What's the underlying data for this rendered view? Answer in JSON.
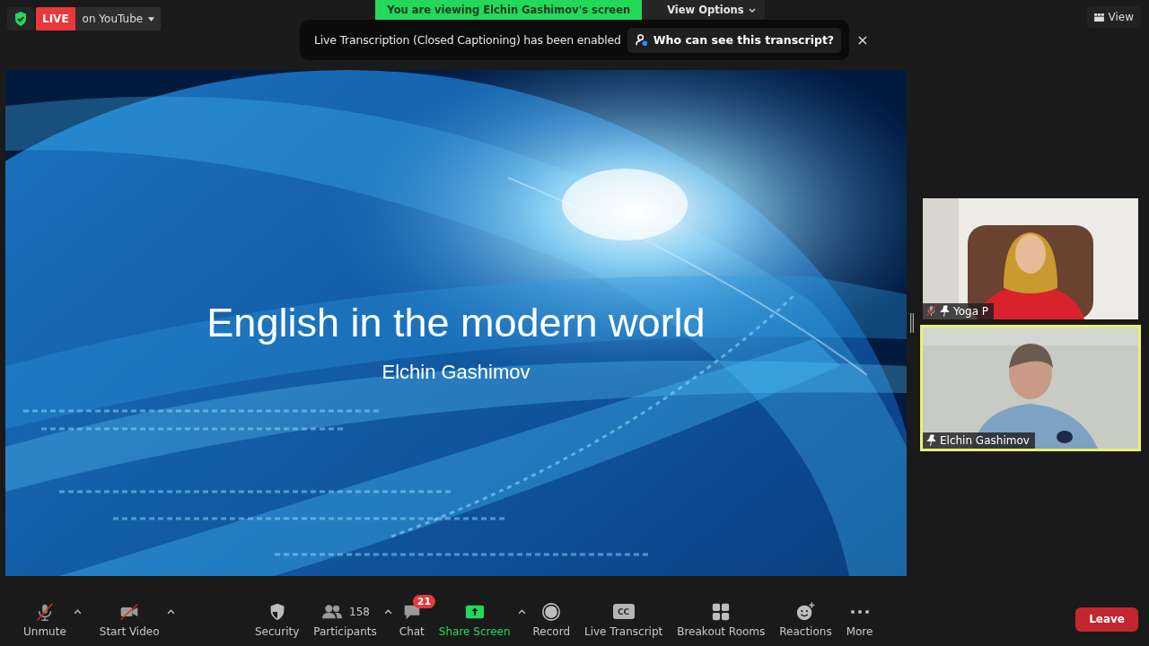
{
  "live": {
    "badge": "LIVE",
    "destination": "on YouTube"
  },
  "banner": {
    "text": "You are viewing Elchin Gashimov's screen",
    "options": "View Options"
  },
  "toast": {
    "text": "Live Transcription (Closed Captioning) has been enabled",
    "link": "Who can see this transcript?",
    "close": "×"
  },
  "view_button": "View",
  "slide": {
    "title": "English in the modern world",
    "subtitle": "Elchin Gashimov"
  },
  "participants": [
    {
      "name": "Yoga P",
      "muted": true,
      "selected": false,
      "kind": "picture"
    },
    {
      "name": "Elchin Gashimov",
      "muted": false,
      "selected": true,
      "kind": "picture"
    }
  ],
  "toolbar": [
    {
      "kind": "mic-off",
      "label": "Unmute",
      "menu": true
    },
    {
      "kind": "video-off",
      "label": "Start Video",
      "menu": true
    },
    {
      "kind": "security",
      "label": "Security",
      "menu": false
    },
    {
      "kind": "participants",
      "label": "Participants",
      "count": "158",
      "menu": true
    },
    {
      "kind": "chat",
      "label": "Chat",
      "badge": "21",
      "menu": false
    },
    {
      "kind": "share",
      "label": "Share Screen",
      "menu": true
    },
    {
      "kind": "record",
      "label": "Record",
      "menu": false
    },
    {
      "kind": "cc",
      "label": "Live Transcript",
      "icon_text": "CC",
      "menu": false
    },
    {
      "kind": "breakout",
      "label": "Breakout Rooms",
      "menu": false
    },
    {
      "kind": "reactions",
      "label": "Reactions",
      "menu": false
    },
    {
      "kind": "more",
      "label": "More",
      "menu": false
    }
  ],
  "leave_button": "Leave"
}
